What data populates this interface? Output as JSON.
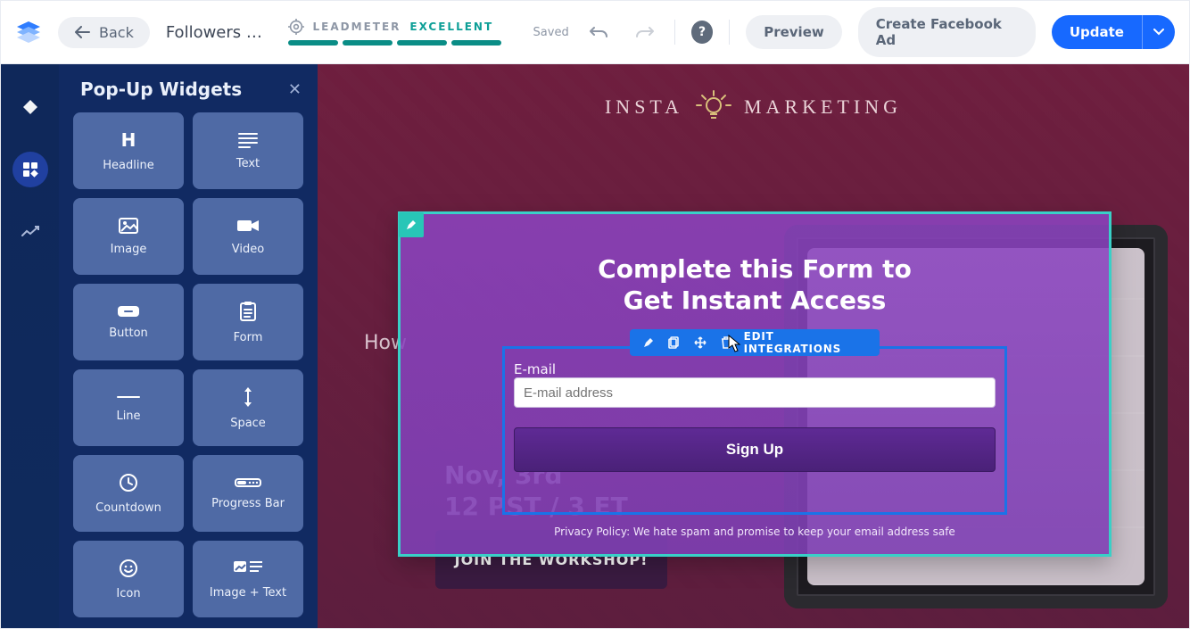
{
  "topbar": {
    "back_label": "Back",
    "doc_name": "Followers W…",
    "leadmeter_label": "LEADMETER",
    "leadmeter_status": "EXCELLENT",
    "saved_label": "Saved",
    "preview_label": "Preview",
    "create_fb_label": "Create Facebook Ad",
    "update_label": "Update"
  },
  "sidebar": {
    "title": "Pop-Up Widgets",
    "close_glyph": "✕",
    "widgets": [
      {
        "key": "headline",
        "label": "Headline"
      },
      {
        "key": "text",
        "label": "Text"
      },
      {
        "key": "image",
        "label": "Image"
      },
      {
        "key": "video",
        "label": "Video"
      },
      {
        "key": "button",
        "label": "Button"
      },
      {
        "key": "form",
        "label": "Form"
      },
      {
        "key": "line",
        "label": "Line"
      },
      {
        "key": "space",
        "label": "Space"
      },
      {
        "key": "countdown",
        "label": "Countdown"
      },
      {
        "key": "progress",
        "label": "Progress Bar"
      },
      {
        "key": "icon",
        "label": "Icon"
      },
      {
        "key": "image_text",
        "label": "Image + Text"
      }
    ]
  },
  "canvas": {
    "brand_left": "INSTA",
    "brand_right": "MARKETING",
    "hero_question_prefix": "How",
    "date_line1": "Nov, 3rd",
    "date_line2": "12 PST / 3 ET",
    "bg_cta": "JOIN THE WORKSHOP!"
  },
  "popup": {
    "headline_line1": "Complete this Form to",
    "headline_line2": "Get Instant Access",
    "toolbar": {
      "edit_integrations": "EDIT INTEGRATIONS"
    },
    "form": {
      "email_label": "E-mail",
      "email_placeholder": "E-mail address",
      "button_label": "Sign Up"
    },
    "policy": "Privacy Policy: We hate spam and promise to keep your email address safe"
  }
}
